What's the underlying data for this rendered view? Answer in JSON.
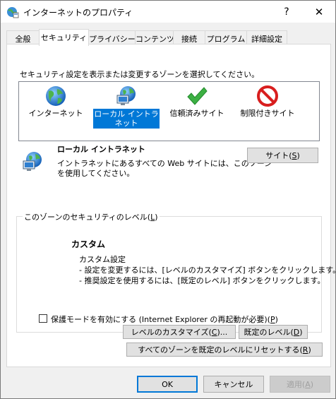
{
  "window": {
    "title": "インターネットのプロパティ",
    "help_glyph": "?",
    "close_glyph": "✕"
  },
  "tabs": [
    {
      "label": "全般",
      "active": false
    },
    {
      "label": "セキュリティ",
      "active": true
    },
    {
      "label": "プライバシー",
      "active": false
    },
    {
      "label": "コンテンツ",
      "active": false
    },
    {
      "label": "接続",
      "active": false
    },
    {
      "label": "プログラム",
      "active": false
    },
    {
      "label": "詳細設定",
      "active": false
    }
  ],
  "security": {
    "zone_prompt": "セキュリティ設定を表示または変更するゾーンを選択してください。",
    "zones": [
      {
        "label": "インターネット",
        "icon": "globe-icon"
      },
      {
        "label": "ローカル イントラネット",
        "icon": "intranet-icon",
        "selected": true
      },
      {
        "label": "信頼済みサイト",
        "icon": "checkmark-icon"
      },
      {
        "label": "制限付きサイト",
        "icon": "restricted-icon"
      }
    ],
    "selected_zone": {
      "title": "ローカル イントラネット",
      "description_line1": "イントラネットにあるすべての Web サイトには、このゾーン",
      "description_line2": "を使用してください。",
      "sites_button": "サイト(",
      "sites_key": "S",
      "sites_suffix": ")"
    },
    "level_group": {
      "title": "このゾーンのセキュリティのレベル(",
      "title_key": "L",
      "title_suffix": ")",
      "level_name": "カスタム",
      "level_subtitle": "カスタム設定",
      "bullet1": "- 設定を変更するには、[レベルのカスタマイズ] ボタンをクリックします。",
      "bullet2": "- 推奨設定を使用するには、[既定のレベル] ボタンをクリックします。"
    },
    "protected_mode": {
      "label": "保護モードを有効にする (Internet Explorer の再起動が必要)(",
      "key": "P",
      "suffix": ")",
      "checked": false
    },
    "customize_button": {
      "label": "レベルのカスタマイズ(",
      "key": "C",
      "suffix": ")..."
    },
    "default_level_button": {
      "label": "既定のレベル(",
      "key": "D",
      "suffix": ")"
    },
    "reset_all_button": {
      "label": "すべてのゾーンを既定のレベルにリセットする(",
      "key": "R",
      "suffix": ")"
    }
  },
  "footer": {
    "ok": "OK",
    "cancel": "キャンセル",
    "apply": "適用(",
    "apply_key": "A",
    "apply_suffix": ")"
  },
  "colors": {
    "accent": "#0078d7",
    "dialog_bg": "#f0f0f0",
    "restricted_red": "#d81e1e",
    "check_green": "#3cb043"
  }
}
